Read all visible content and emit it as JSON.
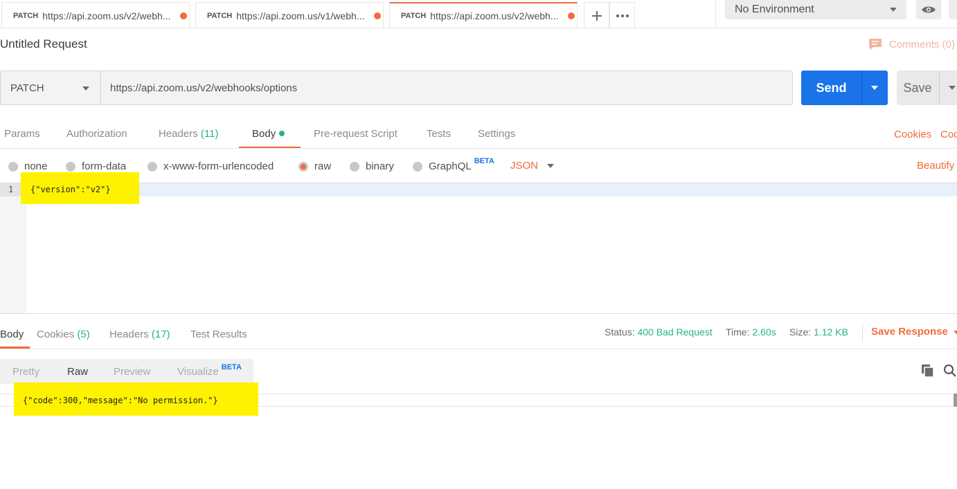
{
  "tabs": [
    {
      "method": "PATCH",
      "url": "https://api.zoom.us/v2/webh..."
    },
    {
      "method": "PATCH",
      "url": "https://api.zoom.us/v1/webh..."
    },
    {
      "method": "PATCH",
      "url": "https://api.zoom.us/v2/webh..."
    }
  ],
  "environment": {
    "selected": "No Environment"
  },
  "request": {
    "title": "Untitled Request",
    "comments_label": "Comments (0)",
    "method": "PATCH",
    "url": "https://api.zoom.us/v2/webhooks/options",
    "send_label": "Send",
    "save_label": "Save"
  },
  "request_tabs": [
    {
      "label": "Params",
      "count": ""
    },
    {
      "label": "Authorization",
      "count": ""
    },
    {
      "label": "Headers",
      "count": "(11)"
    },
    {
      "label": "Body",
      "count": ""
    },
    {
      "label": "Pre-request Script",
      "count": ""
    },
    {
      "label": "Tests",
      "count": ""
    },
    {
      "label": "Settings",
      "count": ""
    }
  ],
  "right_links": {
    "cookies": "Cookies",
    "code": "Code"
  },
  "body_types": {
    "options": [
      "none",
      "form-data",
      "x-www-form-urlencoded",
      "raw",
      "binary",
      "GraphQL"
    ],
    "selected": "raw",
    "graphql_badge": "BETA",
    "format": "JSON",
    "beautify": "Beautify"
  },
  "request_body": {
    "line_number": "1",
    "code": "{\"version\":\"v2\"}"
  },
  "response_tabs": [
    {
      "label": "Body",
      "count": ""
    },
    {
      "label": "Cookies",
      "count": "(5)"
    },
    {
      "label": "Headers",
      "count": "(17)"
    },
    {
      "label": "Test Results",
      "count": ""
    }
  ],
  "response_status": {
    "status_label": "Status:",
    "status_value": "400 Bad Request",
    "time_label": "Time:",
    "time_value": "2.60s",
    "size_label": "Size:",
    "size_value": "1.12 KB",
    "save_response": "Save Response"
  },
  "view_modes": {
    "options": [
      "Pretty",
      "Raw",
      "Preview",
      "Visualize"
    ],
    "selected": "Raw",
    "visualize_badge": "BETA"
  },
  "response_body": {
    "code": "{\"code\":300,\"message\":\"No permission.\"}"
  },
  "colors": {
    "accent": "#f26b3a",
    "send_button": "#1a73e8",
    "success_count": "#26b47f",
    "highlight": "#fff200"
  }
}
